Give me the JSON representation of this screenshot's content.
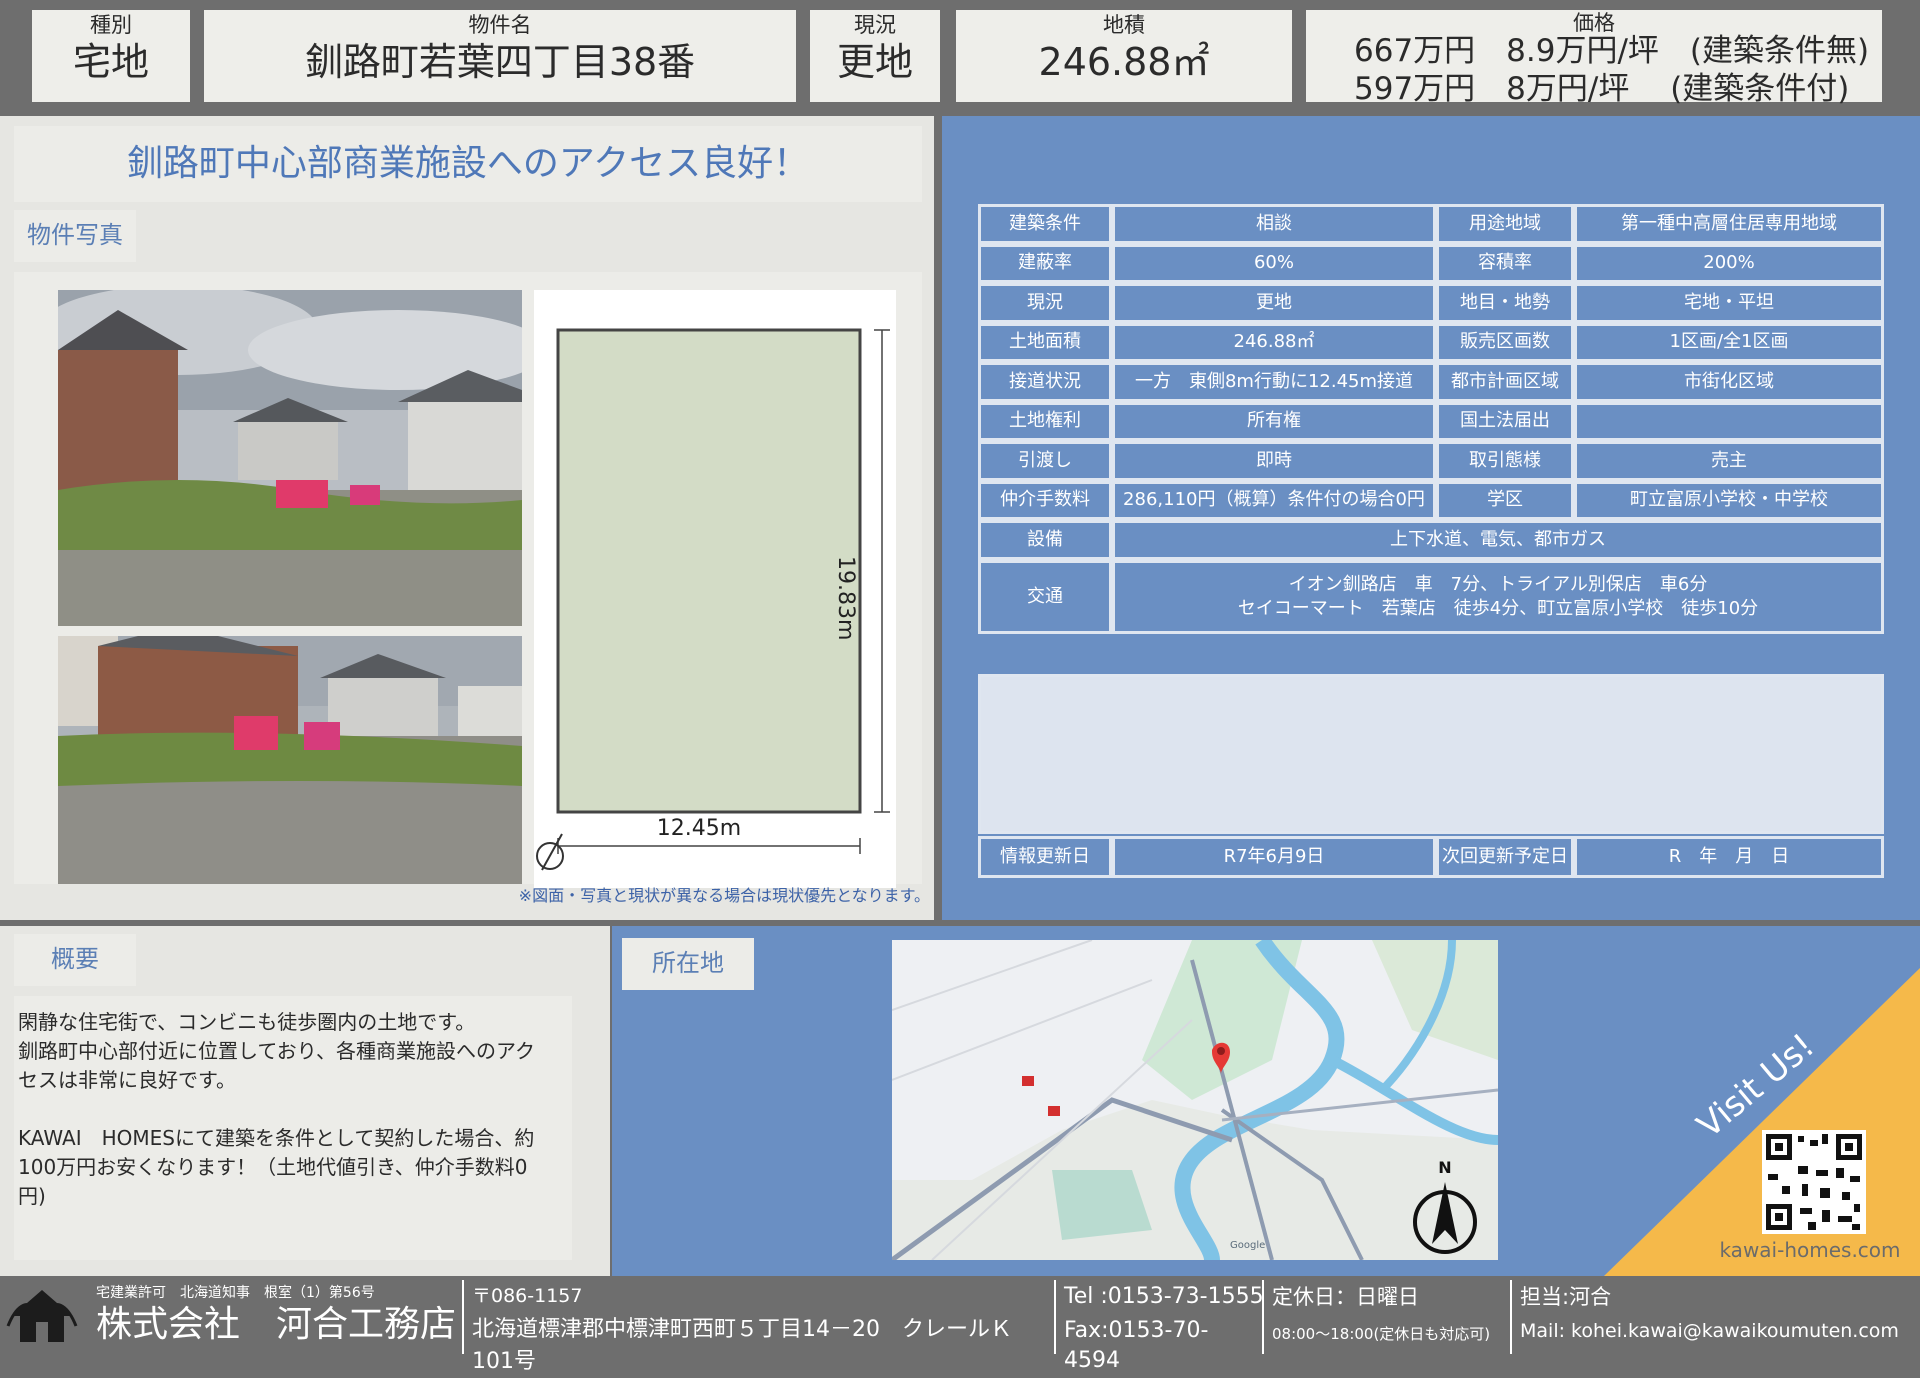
{
  "header": {
    "type_label": "種別",
    "type_value": "宅地",
    "name_label": "物件名",
    "name_value": "釧路町若葉四丁目38番",
    "status_label": "現況",
    "status_value": "更地",
    "area_label": "地積",
    "area_value": "246.88㎡",
    "price_label": "価格",
    "price_line1": "667万円　8.9万円/坪　(建築条件無)",
    "price_line2": "597万円　8万円/坪　 (建築条件付)"
  },
  "headline": "釧路町中心部商業施設へのアクセス良好！",
  "photo_tab": "物件写真",
  "plot": {
    "height_label": "19.83m",
    "width_label": "12.45m"
  },
  "disclaimer": "※図面・写真と現状が異なる場合は現状優先となります。",
  "spec": {
    "rows": [
      [
        "建築条件",
        "相談",
        "用途地域",
        "第一種中高層住居専用地域"
      ],
      [
        "建蔽率",
        "60%",
        "容積率",
        "200%"
      ],
      [
        "現況",
        "更地",
        "地目・地勢",
        "宅地・平坦"
      ],
      [
        "土地面積",
        "246.88㎡",
        "販売区画数",
        "1区画/全1区画"
      ],
      [
        "接道状況",
        "一方　東側8m行動に12.45m接道",
        "都市計画区域",
        "市街化区域"
      ],
      [
        "土地権利",
        "所有権",
        "国土法届出",
        ""
      ],
      [
        "引渡し",
        "即時",
        "取引態様",
        "売主"
      ],
      [
        "仲介手数料",
        "286,110円（概算）条件付の場合0円",
        "学区",
        "町立富原小学校・中学校"
      ]
    ],
    "facility_label": "設備",
    "facility_value": "上下水道、電気、都市ガス",
    "transport_label": "交通",
    "transport_line1": "イオン釧路店　車　7分、トライアル別保店　車6分",
    "transport_line2": "セイコーマート　若葉店　徒歩4分、町立富原小学校　徒歩10分",
    "update_label": "情報更新日",
    "update_value": "R7年6月9日",
    "next_label": "次回更新予定日",
    "next_value": "R　年　月　日"
  },
  "summary": {
    "tab": "概要",
    "line1": "閑静な住宅街で、コンビニも徒歩圏内の土地です。",
    "line2": "釧路町中心部付近に位置しており、各種商業施設へのアク",
    "line3": "セスは非常に良好です。",
    "line4": "KAWAI　HOMESにて建築を条件として契約した場合、約",
    "line5": "100万円お安くなります！（土地代値引き、仲介手数料0",
    "line6": "円)"
  },
  "location": {
    "tab": "所在地",
    "north": "N",
    "google": "Google"
  },
  "visit": {
    "text": "Visit Us!",
    "url": "kawai-homes.com"
  },
  "footer": {
    "license": "宅建業許可　北海道知事　根室（1）第56号",
    "company": "株式会社　河合工務店",
    "zip": "〒086-1157",
    "address": "北海道標津郡中標津町西町５丁目14－20　クレールＫ101号",
    "tel": "Tel :0153-73-1555",
    "fax": "Fax:0153-70-4594",
    "holiday": "定休日：日曜日",
    "hours": "08:00～18:00(定休日も対応可)",
    "staff": "担当:河合",
    "mail": "Mail: kohei.kawai@kawaikoumuten.com"
  },
  "colors": {
    "blue": "#6a8fc3",
    "grey_bar": "#6e6e6e",
    "accent_orange": "#f5b94a",
    "lot_green": "#d3dcc6"
  }
}
